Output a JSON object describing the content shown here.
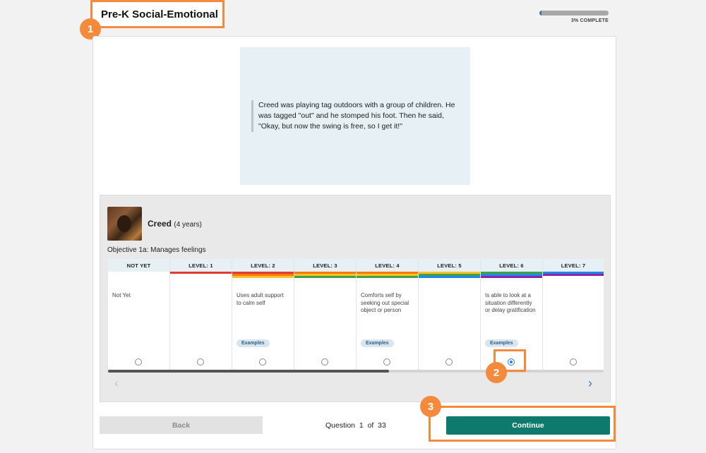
{
  "header": {
    "title": "Pre-K Social-Emotional"
  },
  "progress": {
    "percent": 3,
    "label": "3% COMPLETE"
  },
  "scenario": {
    "text": "Creed was playing tag outdoors with a group of children. He was tagged \"out\" and he stomped his foot. Then he said, \"Okay, but now the swing is free, so I get it!\""
  },
  "child": {
    "name": "Creed",
    "age": "(4 years)"
  },
  "objective": "Objective 1a: Manages feelings",
  "levels": [
    {
      "label": "NOT YET",
      "description": "Not Yet",
      "examples": "",
      "stripe": []
    },
    {
      "label": "LEVEL: 1",
      "description": "",
      "examples": "",
      "stripe": [
        "#e53935"
      ]
    },
    {
      "label": "LEVEL: 2",
      "description": "Uses adult support to calm self",
      "examples": "Examples",
      "stripe": [
        "#e53935",
        "#f57c00",
        "#fbc02d"
      ]
    },
    {
      "label": "LEVEL: 3",
      "description": "",
      "examples": "",
      "stripe": [
        "#f57c00",
        "#fbc02d",
        "#43a047"
      ]
    },
    {
      "label": "LEVEL: 4",
      "description": "Comforts self by seeking out special object or person",
      "examples": "Examples",
      "stripe": [
        "#f57c00",
        "#fbc02d",
        "#43a047"
      ]
    },
    {
      "label": "LEVEL: 5",
      "description": "",
      "examples": "",
      "stripe": [
        "#fbc02d",
        "#43a047",
        "#1e88e5"
      ]
    },
    {
      "label": "LEVEL: 6",
      "description": "Is able to look at a situation differently or delay gratification",
      "examples": "Examples",
      "stripe": [
        "#43a047",
        "#1e88e5",
        "#8e24aa"
      ]
    },
    {
      "label": "LEVEL: 7",
      "description": "",
      "examples": "",
      "stripe": [
        "#1e88e5",
        "#8e24aa"
      ]
    }
  ],
  "selected_level": "LEVEL: 6",
  "buttons": {
    "back": "Back",
    "continue": "Continue"
  },
  "question": {
    "prefix": "Question",
    "current": "1",
    "of": "of",
    "total": "33"
  },
  "callouts": [
    "1",
    "2",
    "3"
  ],
  "icons": {
    "prev": "chevron-left-icon",
    "next": "chevron-right-icon"
  },
  "colors": {
    "accent": "#f58a3c",
    "continue": "#0e7a6e",
    "radio": "#2b7de9"
  }
}
